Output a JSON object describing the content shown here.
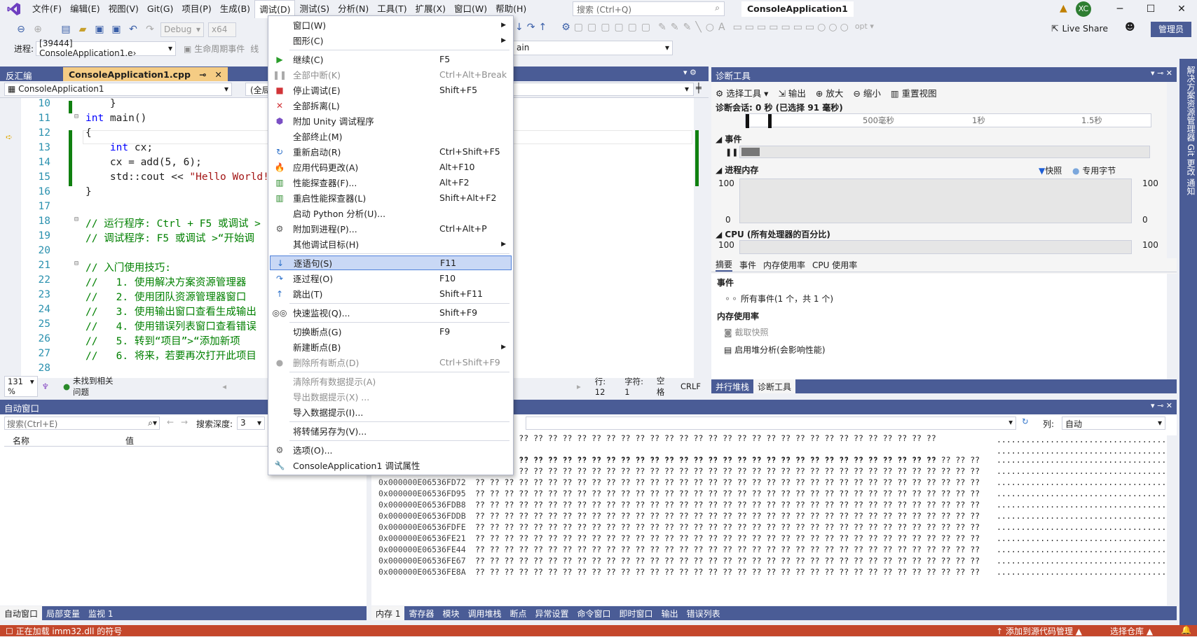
{
  "menubar": {
    "items": [
      "文件(F)",
      "编辑(E)",
      "视图(V)",
      "Git(G)",
      "项目(P)",
      "生成(B)",
      "调试(D)",
      "测试(S)",
      "分析(N)",
      "工具(T)",
      "扩展(X)",
      "窗口(W)",
      "帮助(H)"
    ],
    "search_placeholder": "搜索 (Ctrl+Q)",
    "project_title": "ConsoleApplication1",
    "avatar": "XC"
  },
  "toolbar": {
    "config": "Debug",
    "platform": "x64",
    "live_share": "Live Share",
    "admin": "管理员",
    "process_label": "进程:",
    "process": "[39444] ConsoleApplication1.e›",
    "lifecycle": "生命周期事件",
    "thread_prefix": "线",
    "frame": "ain"
  },
  "editor": {
    "tabs": [
      "反汇编",
      "ConsoleApplication1.cpp"
    ],
    "nav_project": "ConsoleApplication1",
    "nav_scope": "(全局",
    "zoom": "131 %",
    "issues": "未找到相关问题",
    "row": "行: 12",
    "col": "字符: 1",
    "space": "空格",
    "eol": "CRLF",
    "lines": [
      {
        "n": "10",
        "html": "    }"
      },
      {
        "n": "11",
        "html": "<span class=\"kw\">int</span> main()"
      },
      {
        "n": "12",
        "html": "{"
      },
      {
        "n": "13",
        "html": "    <span class=\"kw\">int</span> cx;"
      },
      {
        "n": "14",
        "html": "    cx = add(5, 6);"
      },
      {
        "n": "15",
        "html": "    std::cout &lt;&lt; <span class=\"str\">\"Hello World!\\</span>"
      },
      {
        "n": "16",
        "html": "}"
      },
      {
        "n": "17",
        "html": ""
      },
      {
        "n": "18",
        "html": "<span class=\"cm\">// 运行程序: Ctrl + F5 或调试 &gt;</span>"
      },
      {
        "n": "19",
        "html": "<span class=\"cm\">// 调试程序: F5 或调试 &gt;“开始调</span>"
      },
      {
        "n": "20",
        "html": ""
      },
      {
        "n": "21",
        "html": "<span class=\"cm\">// 入门使用技巧:</span>"
      },
      {
        "n": "22",
        "html": "<span class=\"cm\">//   1. 使用解决方案资源管理器</span>"
      },
      {
        "n": "23",
        "html": "<span class=\"cm\">//   2. 使用团队资源管理器窗口</span>"
      },
      {
        "n": "24",
        "html": "<span class=\"cm\">//   3. 使用输出窗口查看生成输出</span>"
      },
      {
        "n": "25",
        "html": "<span class=\"cm\">//   4. 使用错误列表窗口查看错误</span>"
      },
      {
        "n": "26",
        "html": "<span class=\"cm\">//   5. 转到“项目”&gt;“添加新项                  加现有项”以将现有代码文件添加</span>"
      },
      {
        "n": "27",
        "html": "<span class=\"cm\">//   6. 将来，若要再次打开此项目                 .sln 文件</span>"
      },
      {
        "n": "28",
        "html": ""
      }
    ]
  },
  "debug_menu": [
    {
      "label": "窗口(W)",
      "key": "",
      "icon": "",
      "sub": true,
      "dis": false
    },
    {
      "label": "图形(C)",
      "key": "",
      "icon": "",
      "sub": true,
      "dis": false
    },
    {
      "sep": true
    },
    {
      "label": "继续(C)",
      "key": "F5",
      "icon": "play",
      "sub": false,
      "dis": false
    },
    {
      "label": "全部中断(K)",
      "key": "Ctrl+Alt+Break",
      "icon": "pause",
      "sub": false,
      "dis": true
    },
    {
      "label": "停止调试(E)",
      "key": "Shift+F5",
      "icon": "stop",
      "sub": false,
      "dis": false
    },
    {
      "label": "全部拆离(L)",
      "key": "",
      "icon": "x",
      "sub": false,
      "dis": false
    },
    {
      "label": "附加 Unity 调试程序",
      "key": "",
      "icon": "cube",
      "sub": false,
      "dis": false
    },
    {
      "label": "全部终止(M)",
      "key": "",
      "icon": "",
      "sub": false,
      "dis": false
    },
    {
      "label": "重新启动(R)",
      "key": "Ctrl+Shift+F5",
      "icon": "restart",
      "sub": false,
      "dis": false
    },
    {
      "label": "应用代码更改(A)",
      "key": "Alt+F10",
      "icon": "fire",
      "sub": false,
      "dis": false
    },
    {
      "label": "性能探查器(F)...",
      "key": "Alt+F2",
      "icon": "chart",
      "sub": false,
      "dis": false
    },
    {
      "label": "重启性能探查器(L)",
      "key": "Shift+Alt+F2",
      "icon": "chart",
      "sub": false,
      "dis": false
    },
    {
      "label": "启动 Python 分析(U)...",
      "key": "",
      "icon": "",
      "sub": false,
      "dis": false
    },
    {
      "label": "附加到进程(P)...",
      "key": "Ctrl+Alt+P",
      "icon": "gears",
      "sub": false,
      "dis": false
    },
    {
      "label": "其他调试目标(H)",
      "key": "",
      "icon": "",
      "sub": true,
      "dis": false
    },
    {
      "sep": true
    },
    {
      "label": "逐语句(S)",
      "key": "F11",
      "icon": "stepin",
      "sub": false,
      "dis": false,
      "hl": true
    },
    {
      "label": "逐过程(O)",
      "key": "F10",
      "icon": "stepover",
      "sub": false,
      "dis": false
    },
    {
      "label": "跳出(T)",
      "key": "Shift+F11",
      "icon": "stepout",
      "sub": false,
      "dis": false
    },
    {
      "sep": true
    },
    {
      "label": "快速监视(Q)...",
      "key": "Shift+F9",
      "icon": "glasses",
      "sub": false,
      "dis": false
    },
    {
      "sep": true
    },
    {
      "label": "切换断点(G)",
      "key": "F9",
      "icon": "",
      "sub": false,
      "dis": false
    },
    {
      "label": "新建断点(B)",
      "key": "",
      "icon": "",
      "sub": true,
      "dis": false
    },
    {
      "label": "删除所有断点(D)",
      "key": "Ctrl+Shift+F9",
      "icon": "bpx",
      "sub": false,
      "dis": true
    },
    {
      "sep": true
    },
    {
      "label": "清除所有数据提示(A)",
      "key": "",
      "icon": "",
      "sub": false,
      "dis": true
    },
    {
      "label": "导出数据提示(X) ...",
      "key": "",
      "icon": "",
      "sub": false,
      "dis": true
    },
    {
      "label": "导入数据提示(I)...",
      "key": "",
      "icon": "",
      "sub": false,
      "dis": false
    },
    {
      "sep": true
    },
    {
      "label": "将转储另存为(V)...",
      "key": "",
      "icon": "",
      "sub": false,
      "dis": false
    },
    {
      "sep": true
    },
    {
      "label": "选项(O)...",
      "key": "",
      "icon": "gear",
      "sub": false,
      "dis": false
    },
    {
      "label": "ConsoleApplication1 调试属性",
      "key": "",
      "icon": "wrench",
      "sub": false,
      "dis": false
    }
  ],
  "diag": {
    "title": "诊断工具",
    "select_tool": "选择工具",
    "output": "输出",
    "zoom_in": "放大",
    "zoom_out": "缩小",
    "reset": "重置视图",
    "session": "诊断会话: 0 秒 (已选择 91 毫秒)",
    "ticks": [
      "500毫秒",
      "1秒",
      "1.5秒"
    ],
    "events": "事件",
    "process_memory": "进程内存",
    "snapshot": "快照",
    "private_bytes": "专用字节",
    "mem_max": "100",
    "mem_min": "0",
    "cpu": "CPU (所有处理器的百分比)",
    "cpu_max": "100",
    "tabs": [
      "摘要",
      "事件",
      "内存使用率",
      "CPU 使用率"
    ],
    "events_header": "事件",
    "all_events": "所有事件(1 个，共 1 个)",
    "mem_header": "内存使用率",
    "take_snapshot": "截取快照",
    "heap": "启用堆分析(会影响性能)",
    "bottom_tabs": [
      "并行堆栈",
      "诊断工具"
    ]
  },
  "right_sidebar": "解决方案资源管理器  Git 更改  通知",
  "auto": {
    "title": "自动窗口",
    "search": "搜索(Ctrl+E)",
    "depth_label": "搜索深度:",
    "depth": "3",
    "col_name": "名称",
    "col_value": "值",
    "tabs": [
      "自动窗口",
      "局部变量",
      "监视 1"
    ]
  },
  "memory": {
    "col_label": "列:",
    "col_value": "自动",
    "rows": [
      "0x000000E06536FD2C",
      "0x000000E06536FD4F",
      "0x000000E06536FD72",
      "0x000000E06536FD95",
      "0x000000E06536FDB8",
      "0x000000E06536FDDB",
      "0x000000E06536FDFE",
      "0x000000E06536FE21",
      "0x000000E06536FE44",
      "0x000000E06536FE67",
      "0x000000E06536FE8A"
    ],
    "bytes": "?? ?? ?? ?? ?? ?? ?? ?? ?? ?? ?? ?? ?? ?? ?? ?? ?? ?? ?? ?? ?? ?? ?? ?? ?? ?? ?? ?? ?? ?? ?? ?? ?? ?? ??",
    "ascii": "...................................",
    "tabs": [
      "内存 1",
      "寄存器",
      "模块",
      "调用堆栈",
      "断点",
      "异常设置",
      "命令窗口",
      "即时窗口",
      "输出",
      "错误列表"
    ]
  },
  "status": {
    "left": "正在加载 imm32.dll 的符号",
    "right1": "↑ 添加到源代码管理 ▲",
    "right2": "选择仓库 ▲"
  }
}
